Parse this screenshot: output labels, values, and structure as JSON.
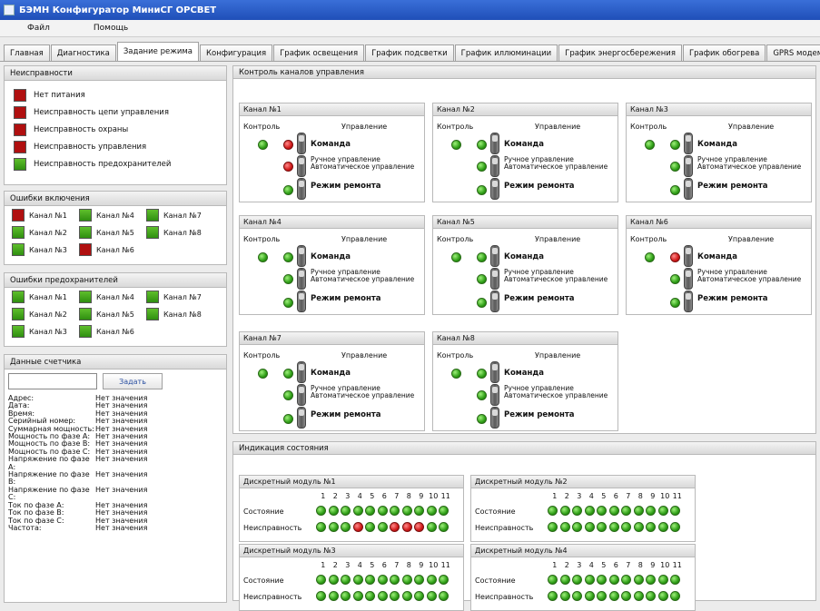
{
  "window": {
    "title": "БЭМН Конфигуратор МиниСГ ОРСВЕТ"
  },
  "menu": [
    "Файл",
    "Помощь"
  ],
  "tabs": [
    "Главная",
    "Диагностика",
    "Задание режима",
    "Конфигурация",
    "График освещения",
    "График подсветки",
    "График иллюминации",
    "График энергосбережения",
    "График обогрева",
    "GPRS модем"
  ],
  "active_tab": 2,
  "faults": {
    "title": "Неисправности",
    "items": [
      {
        "label": "Нет питания",
        "color": "red"
      },
      {
        "label": "Неисправность цепи управления",
        "color": "red"
      },
      {
        "label": "Неисправность охраны",
        "color": "red"
      },
      {
        "label": "Неисправность управления",
        "color": "red"
      },
      {
        "label": "Неисправность предохранителей",
        "color": "green"
      }
    ]
  },
  "switch_errors": {
    "title": "Ошибки включения",
    "items": [
      {
        "label": "Канал №1",
        "color": "red"
      },
      {
        "label": "Канал №4",
        "color": "green"
      },
      {
        "label": "Канал №7",
        "color": "green"
      },
      {
        "label": "Канал №2",
        "color": "green"
      },
      {
        "label": "Канал №5",
        "color": "green"
      },
      {
        "label": "Канал №8",
        "color": "green"
      },
      {
        "label": "Канал №3",
        "color": "green"
      },
      {
        "label": "Канал №6",
        "color": "red"
      }
    ]
  },
  "fuse_errors": {
    "title": "Ошибки предохранителей",
    "items": [
      {
        "label": "Канал №1",
        "color": "green"
      },
      {
        "label": "Канал №4",
        "color": "green"
      },
      {
        "label": "Канал №7",
        "color": "green"
      },
      {
        "label": "Канал №2",
        "color": "green"
      },
      {
        "label": "Канал №5",
        "color": "green"
      },
      {
        "label": "Канал №8",
        "color": "green"
      },
      {
        "label": "Канал №3",
        "color": "green"
      },
      {
        "label": "Канал №6",
        "color": "green"
      }
    ]
  },
  "meter": {
    "title": "Данные счетчика",
    "input_value": "",
    "button": "Задать",
    "rows": [
      {
        "k": "Адрес:",
        "v": "Нет значения"
      },
      {
        "k": "Дата:",
        "v": "Нет значения"
      },
      {
        "k": "Время:",
        "v": "Нет значения"
      },
      {
        "k": "Серийный номер:",
        "v": "Нет значения"
      },
      {
        "k": "Суммарная мощность:",
        "v": "Нет значения"
      },
      {
        "k": "Мощность по фазе А:",
        "v": "Нет значения"
      },
      {
        "k": "Мощность по фазе В:",
        "v": "Нет значения"
      },
      {
        "k": "Мощность по фазе С:",
        "v": "Нет значения"
      },
      {
        "k": "Напряжение по фазе А:",
        "v": "Нет значения"
      },
      {
        "k": "Напряжение по фазе В:",
        "v": "Нет значения"
      },
      {
        "k": "Напряжение по фазе С:",
        "v": "Нет значения"
      },
      {
        "k": "Ток по фазе А:",
        "v": "Нет значения"
      },
      {
        "k": "Ток по фазе В:",
        "v": "Нет значения"
      },
      {
        "k": "Ток по фазе С:",
        "v": "Нет значения"
      },
      {
        "k": "Частота:",
        "v": "Нет значения"
      }
    ]
  },
  "control": {
    "title": "Контроль каналов управления",
    "col_control": "Контроль",
    "col_manage": "Управление",
    "command": "Команда",
    "manual": "Ручное управление",
    "auto": "Автоматическое управление",
    "repair": "Режим ремонта",
    "channels": [
      {
        "name": "Канал №1",
        "control": "green",
        "command": "red",
        "mode": "red",
        "repair": "green"
      },
      {
        "name": "Канал №2",
        "control": "green",
        "command": "green",
        "mode": "green",
        "repair": "green"
      },
      {
        "name": "Канал №3",
        "control": "green",
        "command": "green",
        "mode": "green",
        "repair": "green"
      },
      {
        "name": "Канал №4",
        "control": "green",
        "command": "green",
        "mode": "green",
        "repair": "green"
      },
      {
        "name": "Канал №5",
        "control": "green",
        "command": "green",
        "mode": "green",
        "repair": "green"
      },
      {
        "name": "Канал №6",
        "control": "green",
        "command": "red",
        "mode": "green",
        "repair": "green"
      },
      {
        "name": "Канал №7",
        "control": "green",
        "command": "green",
        "mode": "green",
        "repair": "green"
      },
      {
        "name": "Канал №8",
        "control": "green",
        "command": "green",
        "mode": "green",
        "repair": "green"
      }
    ]
  },
  "indication": {
    "title": "Индикация состояния",
    "state_label": "Состояние",
    "fault_label": "Неисправность",
    "numbers": [
      "1",
      "2",
      "3",
      "4",
      "5",
      "6",
      "7",
      "8",
      "9",
      "10",
      "11"
    ],
    "modules": [
      {
        "name": "Дискретный модуль №1",
        "state": [
          0,
          0,
          0,
          0,
          0,
          0,
          0,
          0,
          0,
          0,
          0
        ],
        "fault": [
          0,
          0,
          0,
          1,
          0,
          0,
          1,
          1,
          1,
          0,
          0
        ]
      },
      {
        "name": "Дискретный модуль №2",
        "state": [
          0,
          0,
          0,
          0,
          0,
          0,
          0,
          0,
          0,
          0,
          0
        ],
        "fault": [
          0,
          0,
          0,
          0,
          0,
          0,
          0,
          0,
          0,
          0,
          0
        ]
      },
      {
        "name": "Дискретный модуль №3",
        "state": [
          0,
          0,
          0,
          0,
          0,
          0,
          0,
          0,
          0,
          0,
          0
        ],
        "fault": [
          0,
          0,
          0,
          0,
          0,
          0,
          0,
          0,
          0,
          0,
          0
        ]
      },
      {
        "name": "Дискретный модуль №4",
        "state": [
          0,
          0,
          0,
          0,
          0,
          0,
          0,
          0,
          0,
          0,
          0
        ],
        "fault": [
          0,
          0,
          0,
          0,
          0,
          0,
          0,
          0,
          0,
          0,
          0
        ]
      }
    ]
  }
}
